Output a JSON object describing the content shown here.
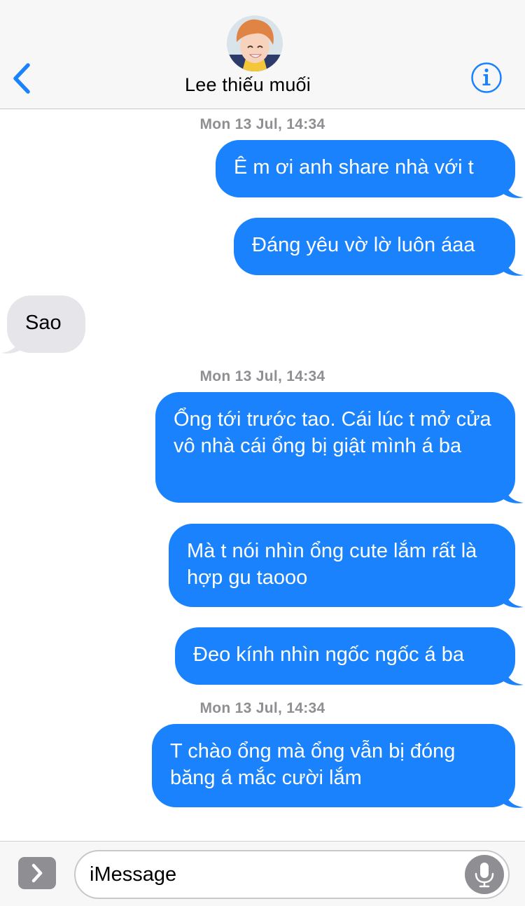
{
  "header": {
    "contact_name": "Lee thiếu muối",
    "back_icon": "chevron-left-icon",
    "info_icon": "info-icon"
  },
  "conversation": {
    "timestamps": [
      "Mon 13 Jul, 14:34",
      "Mon 13 Jul, 14:34",
      "Mon 13 Jul, 14:34"
    ],
    "messages": [
      {
        "direction": "sent",
        "text": "Ê m ơi anh share nhà với t"
      },
      {
        "direction": "sent",
        "text": "Đáng yêu vờ lờ luôn áaa"
      },
      {
        "direction": "received",
        "text": "Sao"
      },
      {
        "direction": "sent",
        "text": "Ổng tới trước tao. Cái lúc t mở cửa vô nhà cái ổng bị giật mình á ba"
      },
      {
        "direction": "sent",
        "text": "Mà t nói nhìn ổng cute lắm rất là hợp gu taooo"
      },
      {
        "direction": "sent",
        "text": "Đeo kính nhìn ngốc ngốc á ba"
      },
      {
        "direction": "sent",
        "text": "T chào ổng mà ổng vẫn bị đóng băng á mắc cười lắm"
      }
    ]
  },
  "input_bar": {
    "placeholder": "iMessage",
    "apps_icon": "chevron-right-icon",
    "mic_icon": "microphone-icon"
  },
  "colors": {
    "sent_bubble": "#1982fc",
    "received_bubble": "#e5e5ea",
    "accent": "#1982fc",
    "timestamp": "#8e8e93"
  }
}
